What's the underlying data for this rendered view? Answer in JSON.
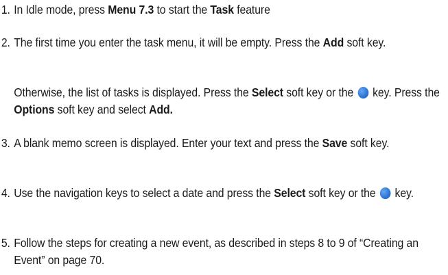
{
  "steps": [
    {
      "number": "1.",
      "t1": "In Idle mode, press ",
      "b1": "Menu 7.3",
      "t2": " to start the ",
      "b2": "Task",
      "t3": " feature"
    },
    {
      "number": "2.",
      "t1": "The first time you enter the task menu, it will be empty. Press the ",
      "b1": "Add",
      "t2": " soft key."
    },
    {
      "number": "3.",
      "t1": "A blank memo screen is displayed. Enter your text and press the ",
      "b1": "Save",
      "t2": " soft key."
    },
    {
      "number": "4.",
      "t1": "Use the navigation keys to select a date and press the ",
      "b1": "Select",
      "t2": " soft key or the ",
      "t3": " key."
    },
    {
      "number": "5.",
      "t1": "Follow the steps for creating a new event, as described in steps 8 to 9 of “Creating an Event” on page 70."
    }
  ],
  "note": {
    "t1": "Otherwise, the list of tasks is displayed. Press the ",
    "b1": "Select",
    "t2": " soft key or the ",
    "t3": " key. Press the ",
    "b2": "Options",
    "t4": " soft key and select ",
    "b3": "Add."
  },
  "icon": "ok-key-icon",
  "icon_color": "#2e78d8"
}
